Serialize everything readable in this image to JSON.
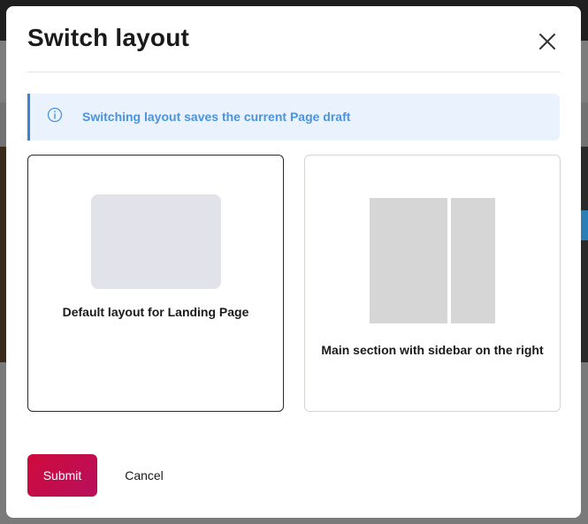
{
  "modal": {
    "title": "Switch layout",
    "close_icon": "close-icon"
  },
  "banner": {
    "icon": "info-icon",
    "text": "Switching layout saves the current Page draft",
    "accent_color": "#3b82d6",
    "background_color": "#eaf3fd"
  },
  "layouts": [
    {
      "label": "Default layout for Landing Page",
      "selected": true
    },
    {
      "label": "Main section with sidebar on the right",
      "selected": false
    }
  ],
  "actions": {
    "submit_label": "Submit",
    "cancel_label": "Cancel",
    "submit_color": "#cf0a3c"
  }
}
